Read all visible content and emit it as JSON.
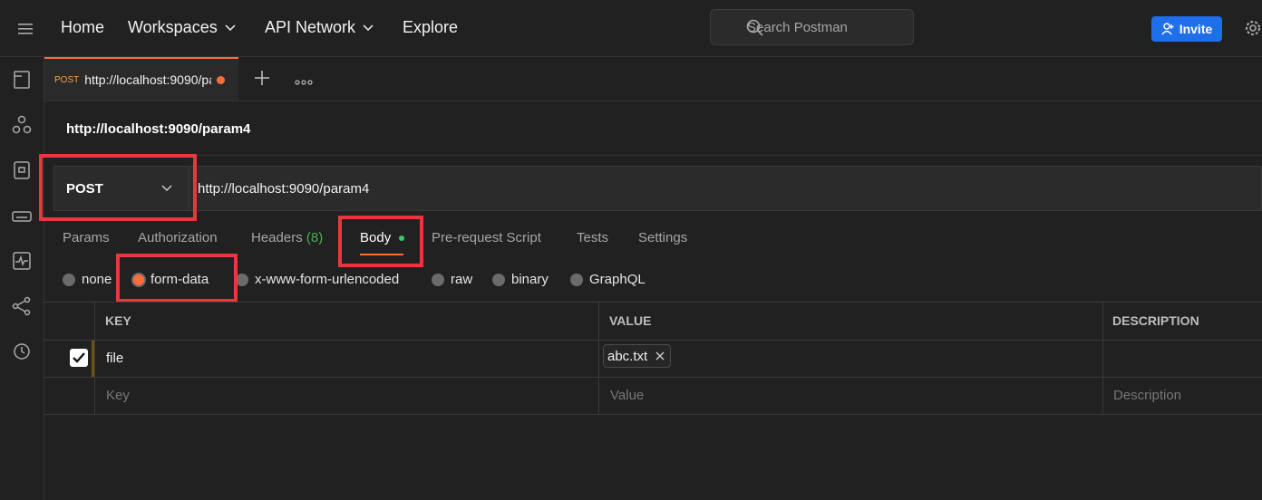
{
  "topbar": {
    "nav": [
      "Home",
      "Workspaces",
      "API Network",
      "Explore"
    ],
    "search_placeholder": "Search Postman",
    "invite_label": "Invite"
  },
  "tab": {
    "method": "POST",
    "url": "http://localhost:9090/param4"
  },
  "request": {
    "title": "http://localhost:9090/param4",
    "method": "POST",
    "url": "http://localhost:9090/param4"
  },
  "request_tabs": {
    "params": "Params",
    "authorization": "Authorization",
    "headers": "Headers",
    "headers_count": "(8)",
    "body": "Body",
    "prerequest": "Pre-request Script",
    "tests": "Tests",
    "settings": "Settings"
  },
  "body_types": {
    "none": "none",
    "form_data": "form-data",
    "urlencoded": "x-www-form-urlencoded",
    "raw": "raw",
    "binary": "binary",
    "graphql": "GraphQL",
    "selected": "form-data"
  },
  "table": {
    "headers": {
      "key": "KEY",
      "value": "VALUE",
      "description": "DESCRIPTION"
    },
    "rows": [
      {
        "key": "file",
        "value": "abc.txt",
        "description": "",
        "checked": true
      }
    ],
    "placeholders": {
      "key": "Key",
      "value": "Value",
      "description": "Description"
    }
  },
  "colors": {
    "accent": "#ff6c37",
    "highlight": "#e8383d",
    "invite": "#1f6feb",
    "headers_count": "#4caf50"
  }
}
